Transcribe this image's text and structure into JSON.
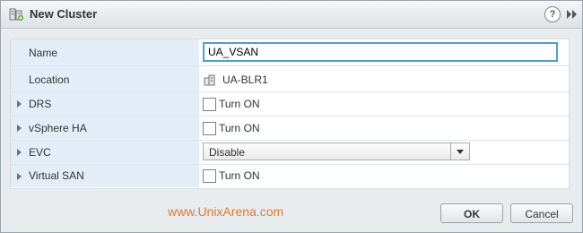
{
  "dialog": {
    "title": "New Cluster",
    "title_icon": "cluster-icon",
    "help_icon_label": "?",
    "expand_icon": "double-chevron-right-icon"
  },
  "form": {
    "name": {
      "label": "Name",
      "value": "UA_VSAN"
    },
    "location": {
      "label": "Location",
      "value": "UA-BLR1",
      "icon": "datacenter-icon"
    },
    "drs": {
      "label": "DRS",
      "checkbox_label": "Turn ON",
      "checked": false
    },
    "vsphere_ha": {
      "label": "vSphere HA",
      "checkbox_label": "Turn ON",
      "checked": false
    },
    "evc": {
      "label": "EVC",
      "selected": "Disable"
    },
    "virtual_san": {
      "label": "Virtual SAN",
      "checkbox_label": "Turn ON",
      "checked": false
    }
  },
  "footer": {
    "watermark": "www.UnixArena.com",
    "ok_label": "OK",
    "cancel_label": "Cancel"
  },
  "colors": {
    "label_background": "#e3edf7",
    "input_focus_border": "#4f9fc8",
    "watermark": "#e07a2e"
  }
}
